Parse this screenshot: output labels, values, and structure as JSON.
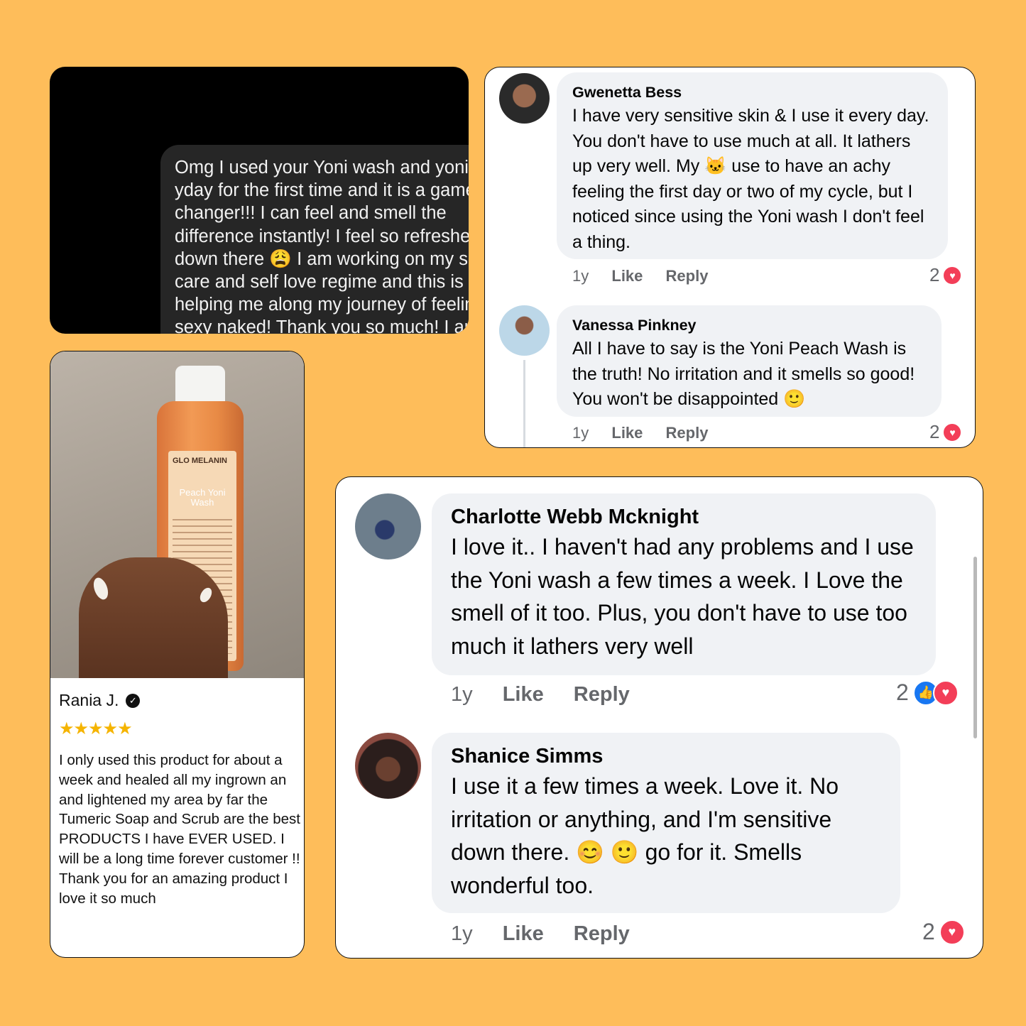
{
  "dm": {
    "message": "Omg I used your Yoni wash and yoni oil yday for the first time and it is a game changer!!! I can feel and smell the difference instantly! I feel so refreshed down there 😩 I am working on my self care and self love regime and this is helping me along my journey of feeling sexy naked! Thank you so much! I am def purchasing more from you!"
  },
  "top_comments": [
    {
      "name": "Gwenetta Bess",
      "text": "I have very sensitive skin & I use it every day. You don't have to use much at all. It lathers up very well. My 🐱 use to have an achy feeling the first day or two of my cycle, but I noticed since using the Yoni wash I don't feel a thing.",
      "ago": "1y",
      "like": "Like",
      "reply": "Reply",
      "reactions": "2"
    },
    {
      "name": "Vanessa Pinkney",
      "text": "All I have to say is the Yoni Peach Wash is the truth! No irritation and it smells so good! You won't be disappointed 🙂",
      "ago": "1y",
      "like": "Like",
      "reply": "Reply",
      "reactions": "2"
    }
  ],
  "review": {
    "name": "Rania J.",
    "stars": "★★★★★",
    "rating": 5,
    "text": "I only used this product for about a week and healed all my ingrown an and lightened my area by far the Tumeric Soap and Scrub are the best PRODUCTS I have EVER USED. I will be a long time forever customer !! Thank you for an amazing product I love it so much",
    "bottle_brand": "GLO MELANIN",
    "bottle_name": "Peach Yoni Wash"
  },
  "bottom_comments": [
    {
      "name": "Charlotte Webb Mcknight",
      "text": "I love it.. I haven't had any problems and I use the Yoni wash a few times a week. I Love the smell of it too. Plus, you don't have to use too much it lathers very well",
      "ago": "1y",
      "like": "Like",
      "reply": "Reply",
      "reactions": "2"
    },
    {
      "name": "Shanice Simms",
      "text": "I use it a few times a week. Love it. No irritation or anything, and I'm sensitive down there. 😊 🙂 go for it. Smells wonderful too.",
      "ago": "1y",
      "like": "Like",
      "reply": "Reply",
      "reactions": "2"
    }
  ],
  "colors": {
    "background": "#FEBD5A",
    "heart": "#F33E58",
    "like": "#1877F2",
    "star": "#F5B400"
  }
}
